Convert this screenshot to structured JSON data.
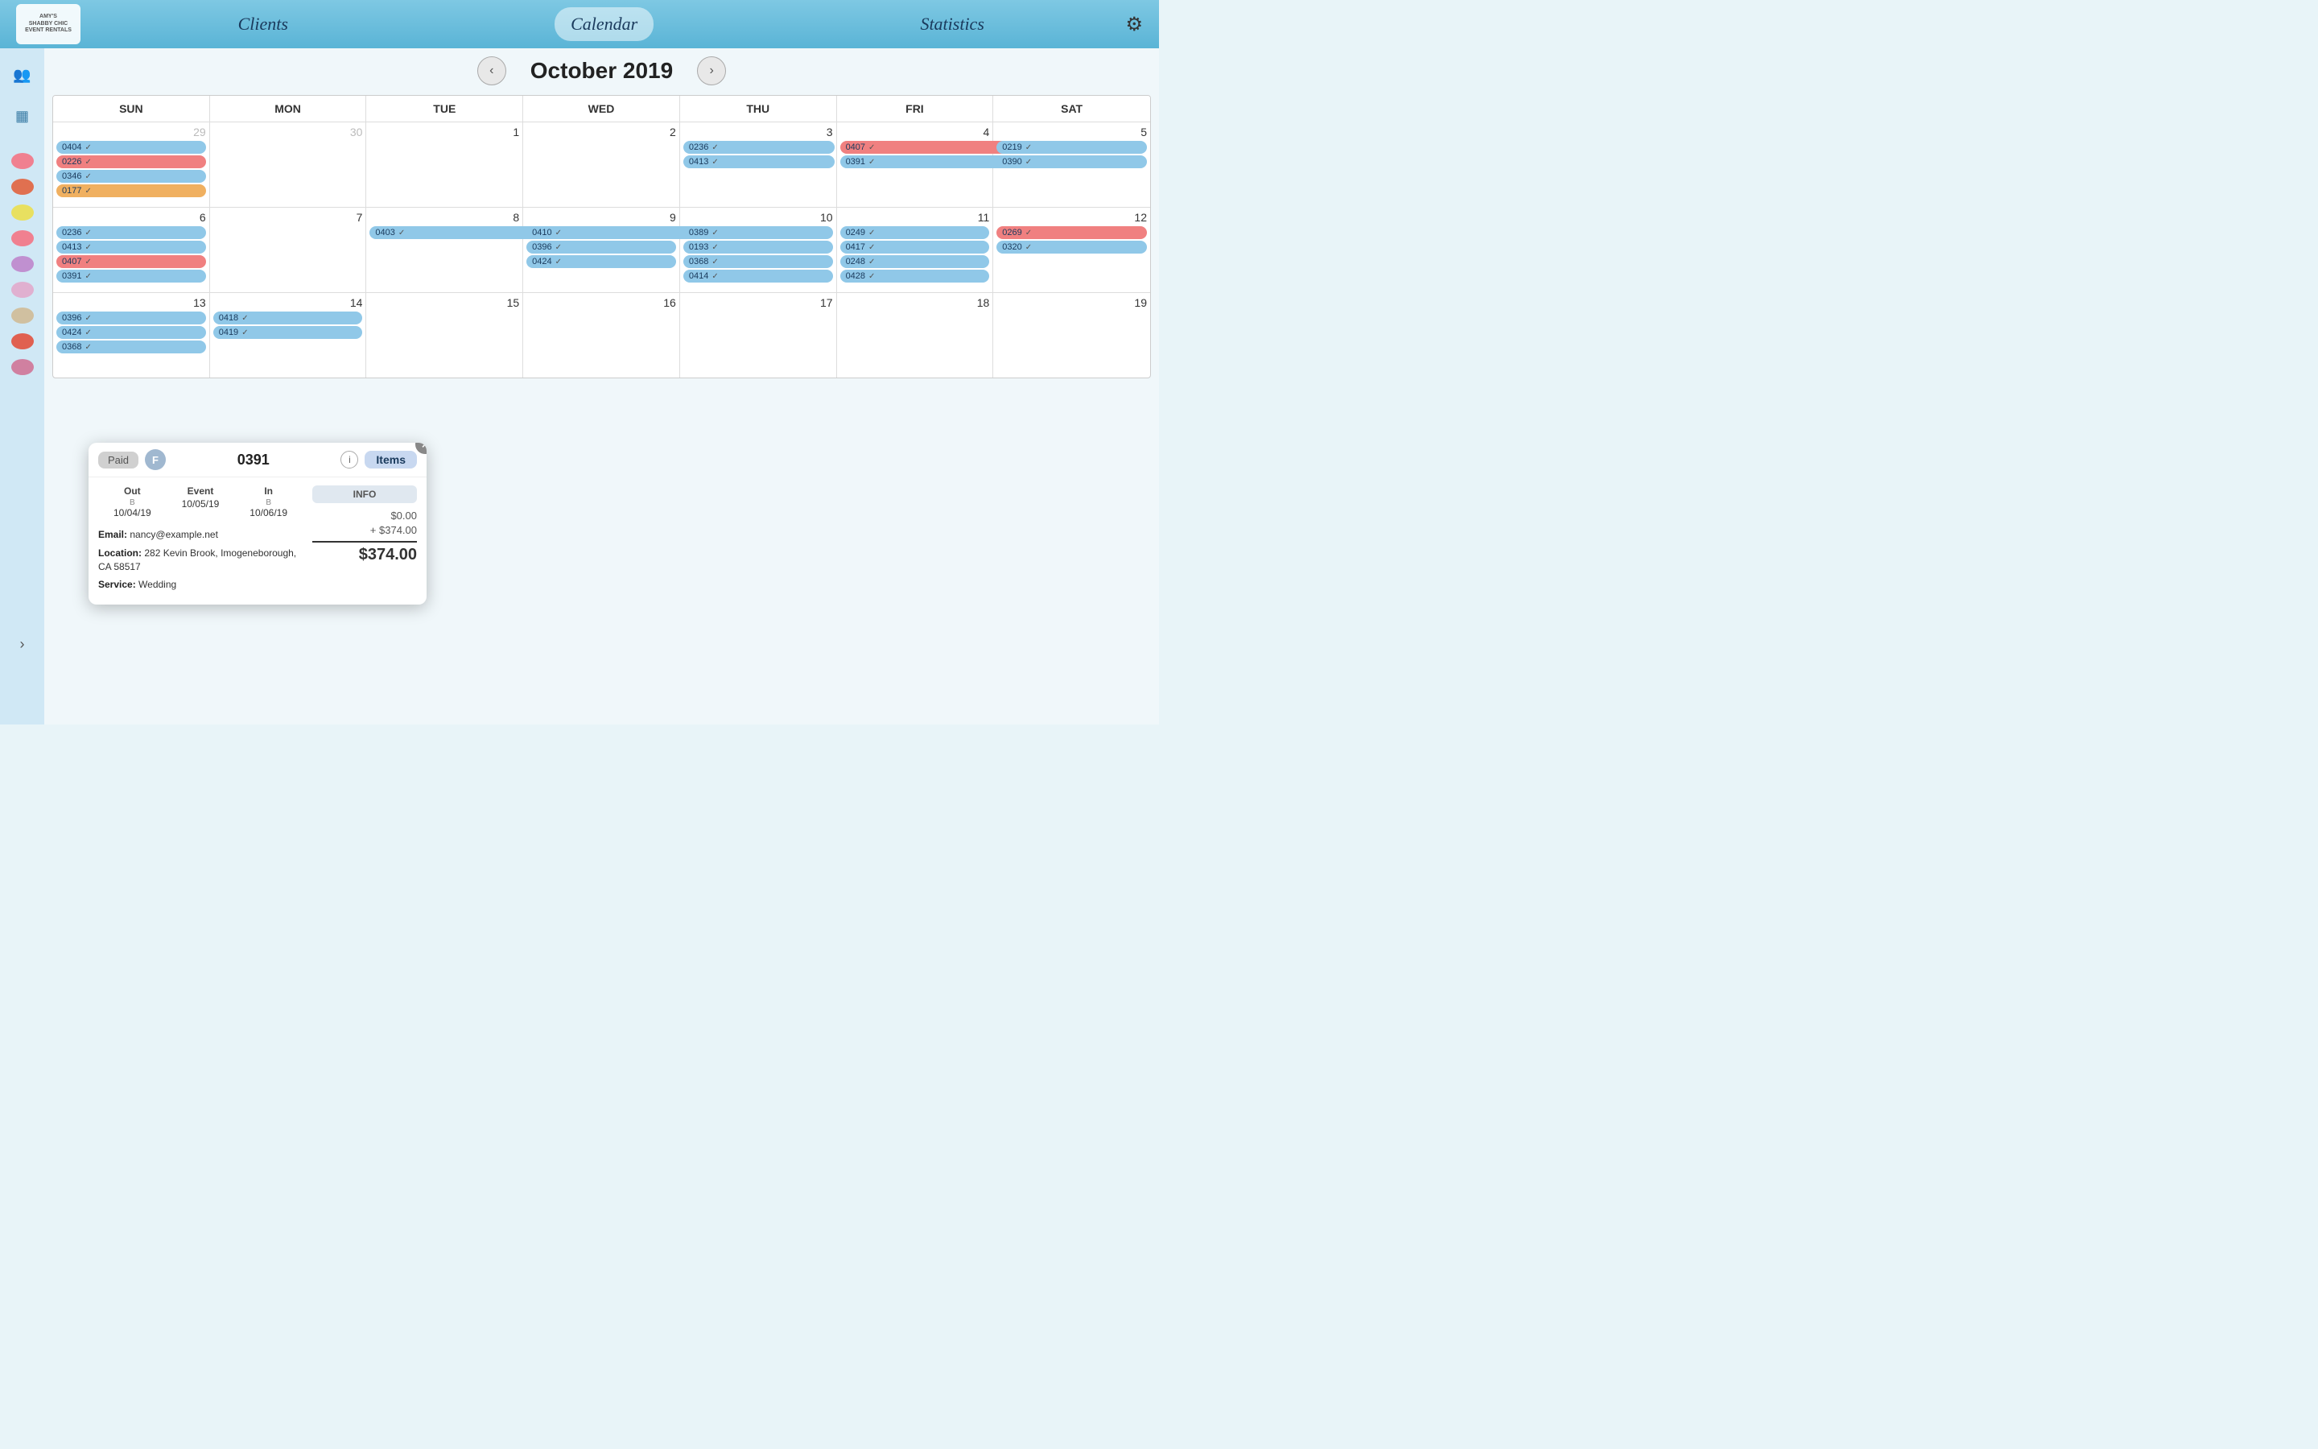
{
  "app": {
    "title": "Amy's Shabby Chic Event Rentals"
  },
  "nav": {
    "clients_label": "Clients",
    "calendar_label": "Calendar",
    "statistics_label": "Statistics"
  },
  "calendar": {
    "month_year": "October 2019",
    "prev_label": "‹",
    "next_label": "›",
    "days": [
      "SUN",
      "MON",
      "TUE",
      "WED",
      "THU",
      "FRI",
      "SAT"
    ],
    "weeks": [
      {
        "cells": [
          {
            "day": "29",
            "other": true,
            "events": [
              {
                "id": "0404",
                "color": "blue",
                "check": true
              },
              {
                "id": "0226",
                "color": "red",
                "check": true
              },
              {
                "id": "0346",
                "color": "blue",
                "check": true
              },
              {
                "id": "0177",
                "color": "orange",
                "check": true
              }
            ]
          },
          {
            "day": "30",
            "other": true,
            "events": []
          },
          {
            "day": "1",
            "events": []
          },
          {
            "day": "2",
            "events": []
          },
          {
            "day": "3",
            "events": [
              {
                "id": "0236",
                "color": "blue",
                "check": true
              },
              {
                "id": "0413",
                "color": "blue",
                "check": true
              }
            ]
          },
          {
            "day": "4",
            "events": [
              {
                "id": "0407",
                "color": "red",
                "check": true
              },
              {
                "id": "0391",
                "color": "blue",
                "check": true
              }
            ]
          },
          {
            "day": "5",
            "events": [
              {
                "id": "0219",
                "color": "blue",
                "check": true
              },
              {
                "id": "0390",
                "color": "blue",
                "check": true
              }
            ]
          }
        ]
      },
      {
        "cells": [
          {
            "day": "6",
            "events": [
              {
                "id": "0236",
                "color": "blue",
                "check": true
              },
              {
                "id": "0413",
                "color": "blue",
                "check": true
              },
              {
                "id": "0407",
                "color": "red",
                "check": true
              },
              {
                "id": "0391",
                "color": "blue",
                "check": true
              }
            ]
          },
          {
            "day": "7",
            "events": []
          },
          {
            "day": "8",
            "events": [
              {
                "id": "0403",
                "color": "blue",
                "check": true,
                "span": true
              }
            ]
          },
          {
            "day": "9",
            "events": [
              {
                "id": "0410",
                "color": "blue",
                "check": true,
                "span": true
              },
              {
                "id": "0396",
                "color": "blue",
                "check": true
              },
              {
                "id": "0424",
                "color": "blue",
                "check": true
              }
            ]
          },
          {
            "day": "10",
            "events": [
              {
                "id": "0389",
                "color": "blue",
                "check": true
              },
              {
                "id": "0193",
                "color": "blue",
                "check": true
              },
              {
                "id": "0368",
                "color": "blue",
                "check": true
              },
              {
                "id": "0414",
                "color": "blue",
                "check": true
              }
            ]
          },
          {
            "day": "11",
            "events": [
              {
                "id": "0249",
                "color": "blue",
                "check": true
              },
              {
                "id": "0417",
                "color": "blue",
                "check": true
              },
              {
                "id": "0248",
                "color": "blue",
                "check": true
              },
              {
                "id": "0428",
                "color": "blue",
                "check": true
              }
            ]
          },
          {
            "day": "12",
            "events": [
              {
                "id": "0269",
                "color": "red",
                "check": true
              },
              {
                "id": "0320",
                "color": "blue",
                "check": true
              }
            ]
          }
        ]
      },
      {
        "cells": [
          {
            "day": "13",
            "events": [
              {
                "id": "0396",
                "color": "blue",
                "check": true
              },
              {
                "id": "0424",
                "color": "blue",
                "check": true
              },
              {
                "id": "0368",
                "color": "blue",
                "check": true
              }
            ]
          },
          {
            "day": "14",
            "events": [
              {
                "id": "0418",
                "color": "blue",
                "check": true
              },
              {
                "id": "0419",
                "color": "blue",
                "check": true
              }
            ]
          },
          {
            "day": "15",
            "events": []
          },
          {
            "day": "16",
            "events": []
          },
          {
            "day": "17",
            "events": []
          },
          {
            "day": "18",
            "events": []
          },
          {
            "day": "19",
            "today": true,
            "events": []
          }
        ]
      }
    ]
  },
  "sidebar": {
    "icons": [
      {
        "name": "users-icon",
        "symbol": "👥"
      },
      {
        "name": "grid-icon",
        "symbol": "▦"
      }
    ],
    "ovals": [
      {
        "color": "#f08090"
      },
      {
        "color": "#e07050"
      },
      {
        "color": "#e8e060"
      },
      {
        "color": "#f08090"
      },
      {
        "color": "#c090d0"
      },
      {
        "color": "#e0b0d0"
      },
      {
        "color": "#d0c0a0"
      },
      {
        "color": "#e06050"
      },
      {
        "color": "#d080a0"
      }
    ]
  },
  "popup": {
    "paid_label": "Paid",
    "f_label": "F",
    "order_num": "0391",
    "info_label": "i",
    "items_label": "Items",
    "close_label": "×",
    "dates": {
      "out_label": "Out",
      "out_sub": "B",
      "out_val": "10/04/19",
      "event_label": "Event",
      "event_val": "10/05/19",
      "in_label": "In",
      "in_sub": "B",
      "in_val": "10/06/19"
    },
    "email_label": "Email:",
    "email_val": "nancy@example.net",
    "location_label": "Location:",
    "location_val": "282 Kevin Brook, Imogeneborough, CA 58517",
    "service_label": "Service:",
    "service_val": "Wedding",
    "info_tab_label": "INFO",
    "price_base": "$0.00",
    "price_add": "+ $374.00",
    "price_total": "$374.00"
  }
}
